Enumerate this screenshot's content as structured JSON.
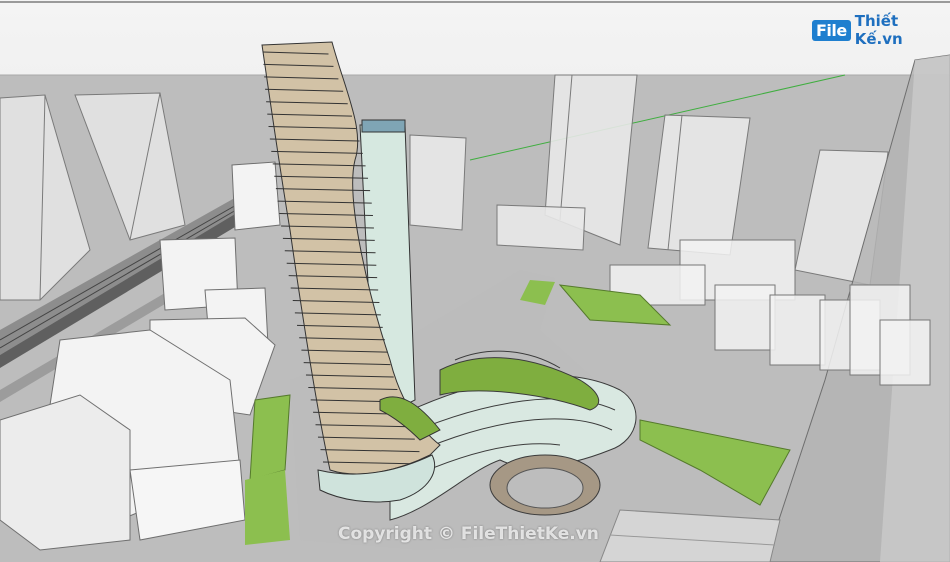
{
  "logo": {
    "file_part": "File",
    "rest_part": "Thiết Kế.vn"
  },
  "watermark": {
    "text": "Copyright © FileThietKe.vn"
  },
  "colors": {
    "sky": "#ececec",
    "ground": "#b8b8b8",
    "grass": "#8cbf4f",
    "facade_glass": "#cfe3dc",
    "facade_warm": "#c9ab85",
    "logo_blue": "#1f7fcf"
  }
}
